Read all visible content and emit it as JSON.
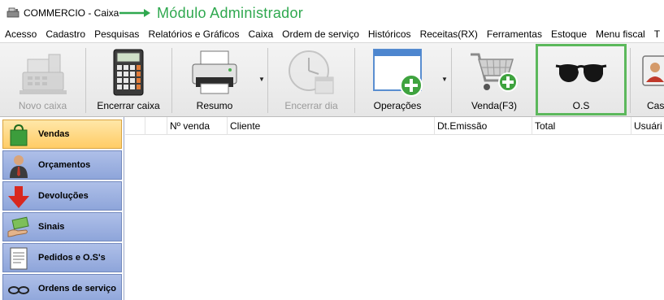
{
  "window": {
    "title": "COMMERCIO - Caixa",
    "module_label": "Módulo Administrador",
    "arrow_color": "#2fa84f"
  },
  "menu": [
    "Acesso",
    "Cadastro",
    "Pesquisas",
    "Relatórios e Gráficos",
    "Caixa",
    "Ordem de serviço",
    "Históricos",
    "Receitas(RX)",
    "Ferramentas",
    "Estoque",
    "Menu fiscal",
    "T"
  ],
  "toolbar": {
    "novo_caixa": "Novo caixa",
    "encerrar_caixa": "Encerrar caixa",
    "resumo": "Resumo",
    "encerrar_dia": "Encerrar dia",
    "operacoes": "Operações",
    "venda": "Venda(F3)",
    "os": "O.S",
    "cash": "Cash",
    "highlight_color": "#5cb85c"
  },
  "sidebar": {
    "items": [
      {
        "label": "Vendas",
        "icon": "shopping-bag-icon",
        "active": true
      },
      {
        "label": "Orçamentos",
        "icon": "businessman-icon",
        "active": false
      },
      {
        "label": "Devoluções",
        "icon": "red-down-arrow-icon",
        "active": false
      },
      {
        "label": "Sinais",
        "icon": "money-hand-icon",
        "active": false
      },
      {
        "label": "Pedidos e O.S's",
        "icon": "document-icon",
        "active": false
      },
      {
        "label": "Ordens de serviço",
        "icon": "glasses-icon",
        "active": false
      }
    ]
  },
  "grid": {
    "columns": [
      "Nº venda",
      "Cliente",
      "Dt.Emissão",
      "Total",
      "Usuári"
    ],
    "rows": []
  }
}
